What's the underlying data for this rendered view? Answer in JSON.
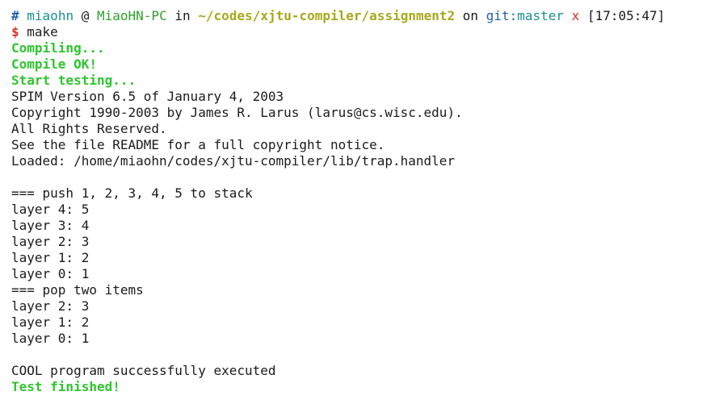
{
  "prompt": {
    "hash": "#",
    "user": "miaohn",
    "at": "@",
    "host": "MiaoHN-PC",
    "in": "in",
    "path": "~/codes/xjtu-compiler/assignment2",
    "on": "on",
    "git_label": "git:",
    "branch": "master",
    "dirty": "x",
    "time": "[17:05:47]"
  },
  "command": {
    "symbol": "$",
    "text": "make"
  },
  "status": {
    "compiling": "Compiling...",
    "compile_ok": "Compile OK!",
    "start_testing": "Start testing...",
    "test_finished": "Test finished!"
  },
  "output": [
    "SPIM Version 6.5 of January 4, 2003",
    "Copyright 1990-2003 by James R. Larus (larus@cs.wisc.edu).",
    "All Rights Reserved.",
    "See the file README for a full copyright notice.",
    "Loaded: /home/miaohn/codes/xjtu-compiler/lib/trap.handler",
    "",
    "=== push 1, 2, 3, 4, 5 to stack",
    "layer 4: 5",
    "layer 3: 4",
    "layer 2: 3",
    "layer 1: 2",
    "layer 0: 1",
    "=== pop two items",
    "layer 2: 3",
    "layer 1: 2",
    "layer 0: 1",
    "",
    "COOL program successfully executed"
  ]
}
